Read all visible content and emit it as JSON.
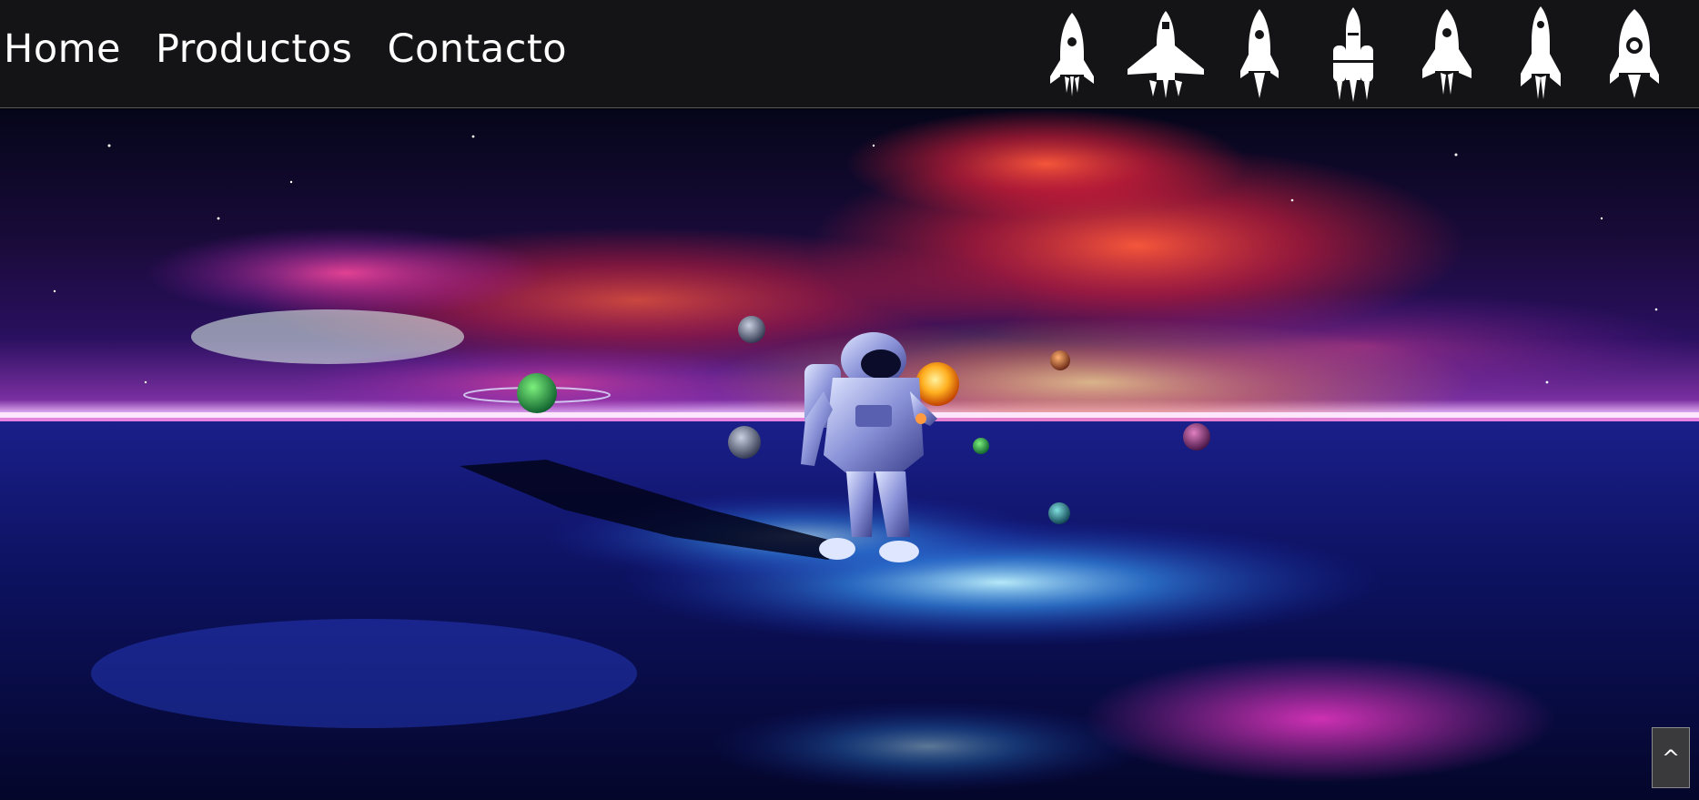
{
  "nav": {
    "links": [
      "Home",
      "Productos",
      "Contacto"
    ]
  },
  "rockets": [
    {
      "icon": "rocket-icon"
    },
    {
      "icon": "space-shuttle-icon"
    },
    {
      "icon": "rocket-icon"
    },
    {
      "icon": "multi-stage-rocket-icon"
    },
    {
      "icon": "rocket-icon"
    },
    {
      "icon": "rocket-icon"
    },
    {
      "icon": "rocket-porthole-icon"
    }
  ],
  "hero": {
    "image": "astronaut-in-space-image"
  },
  "scroll_top": {
    "label": "^"
  },
  "colors": {
    "navbar_bg": "#141416",
    "nav_text": "#ffffff",
    "scroll_button_bg": "#3a3a3c"
  }
}
